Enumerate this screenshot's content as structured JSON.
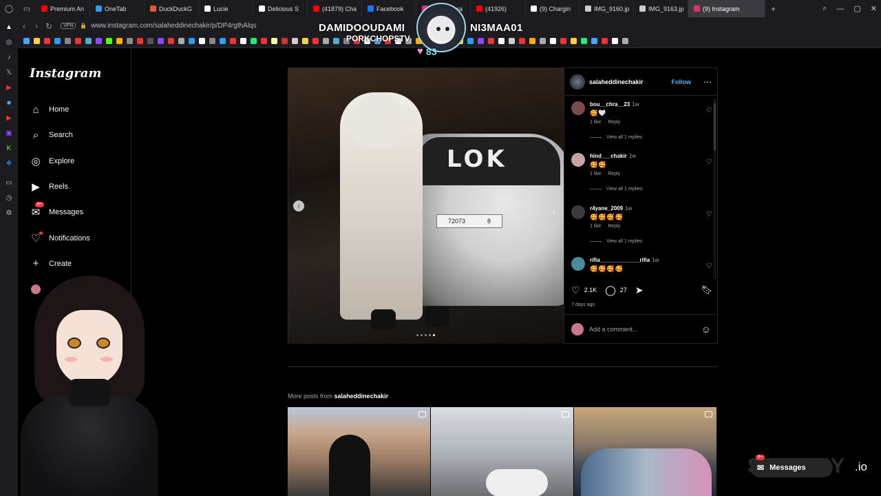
{
  "browser": {
    "tabs": [
      {
        "label": "Premium An",
        "color": "#ff0000"
      },
      {
        "label": "OneTab",
        "color": "#2a9df4"
      },
      {
        "label": "DuckDuckG",
        "color": "#de5833"
      },
      {
        "label": "Lucie",
        "color": "#ffffff"
      },
      {
        "label": "Delicious S",
        "color": "#ffffff"
      },
      {
        "label": "(41879) Cha",
        "color": "#ff0000"
      },
      {
        "label": "Facebook",
        "color": "#1877f2"
      },
      {
        "label": "(9) Instagra",
        "color": "#e1306c"
      },
      {
        "label": "(41926)",
        "color": "#ff0000"
      },
      {
        "label": "(9) Chargin",
        "color": "#ffffff"
      },
      {
        "label": "IMG_9160.jp",
        "color": "#cccccc"
      },
      {
        "label": "IMG_9163.jp",
        "color": "#cccccc"
      },
      {
        "label": "(9) Instagram",
        "color": "#e1306c",
        "active": true
      }
    ],
    "new_tab": "+",
    "url": "www.instagram.com/salaheddinechakir/p/DP4rgthAlqs",
    "vpn_label": "VPN"
  },
  "nav": {
    "logo": "Instagram",
    "items": [
      {
        "label": "Home",
        "icon": "home-icon"
      },
      {
        "label": "Search",
        "icon": "search-icon"
      },
      {
        "label": "Explore",
        "icon": "compass-icon"
      },
      {
        "label": "Reels",
        "icon": "reels-icon"
      },
      {
        "label": "Messages",
        "icon": "messenger-icon",
        "badge": "9+"
      },
      {
        "label": "Notifications",
        "icon": "heart-icon",
        "dot": true
      },
      {
        "label": "Create",
        "icon": "plus-icon"
      }
    ]
  },
  "post": {
    "username": "salaheddinechakir",
    "follow_label": "Follow",
    "plate_left": "72073",
    "plate_right": "8",
    "car_text": "LOK",
    "comments": [
      {
        "user": "bou__chra__23",
        "ago": "1w",
        "emoji": "🥰🤍",
        "likes": "1 like",
        "reply": "Reply",
        "view": "View all 1 replies"
      },
      {
        "user": "hind___chakir",
        "ago": "1w",
        "emoji": "🥰🥰",
        "likes": "1 like",
        "reply": "Reply",
        "view": "View all 1 replies"
      },
      {
        "user": "r4yane_2009",
        "ago": "1w",
        "emoji": "🥰🥰🥰🥰",
        "likes": "1 like",
        "reply": "Reply",
        "view": "View all 1 replies"
      },
      {
        "user": "rifia_____________rifia",
        "ago": "1w",
        "emoji": "🥰🥰🥰🥰",
        "likes": "",
        "reply": "",
        "view": ""
      }
    ],
    "like_count": "2.1K",
    "comment_count": "27",
    "date": "7 days ago",
    "add_comment_placeholder": "Add a comment..."
  },
  "more_posts": {
    "prefix": "More posts from",
    "username": "salaheddinechakir"
  },
  "overlay": {
    "streamer_left": "DAMIDOOUDAMI",
    "streamer_sub": "PORKCHOPSTV",
    "streamer_right": "NI3MAA01",
    "hearts": "83"
  },
  "floating_messages": {
    "label": "Messages",
    "badge": "9+",
    "brand": "SKINNNY",
    "tld": ".io"
  }
}
